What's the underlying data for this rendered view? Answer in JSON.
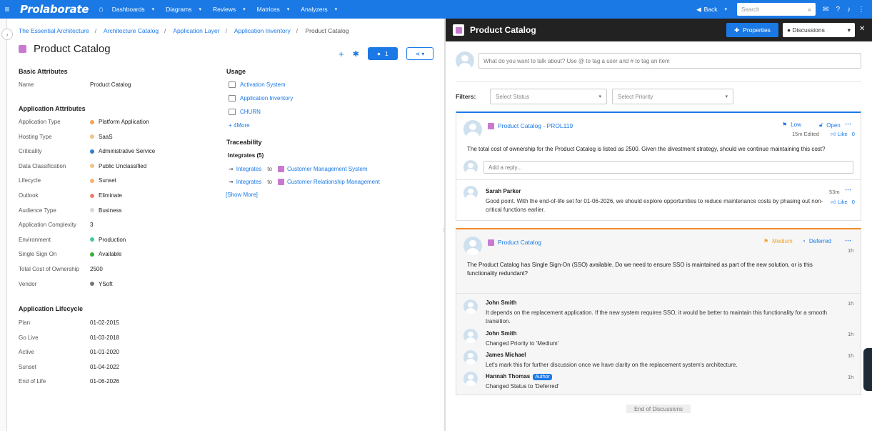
{
  "topbar": {
    "logo": "Prolaborate",
    "nav": [
      "Dashboards",
      "Diagrams",
      "Reviews",
      "Matrices",
      "Analyzers"
    ],
    "back_label": "Back",
    "search_placeholder": "Search",
    "accent": "#1b79e6"
  },
  "breadcrumb": [
    "The Essential Architecture",
    "Architecture Catalog",
    "Application Layer",
    "Application Inventory",
    "Product Catalog"
  ],
  "page": {
    "title": "Product Catalog",
    "comment_count": "1"
  },
  "basic": {
    "title": "Basic Attributes",
    "rows": [
      {
        "label": "Name",
        "value": "Product Catalog"
      }
    ]
  },
  "app_attrs": {
    "title": "Application Attributes",
    "rows": [
      {
        "label": "Application Type",
        "value": "Platform Application",
        "color": "#f5a35a"
      },
      {
        "label": "Hosting Type",
        "value": "SaaS",
        "color": "#f5c08a"
      },
      {
        "label": "Criticality",
        "value": "Administrative Service",
        "color": "#2f7fd0"
      },
      {
        "label": "Data Classification",
        "value": "Public Unclassified",
        "color": "#f5c08a"
      },
      {
        "label": "Lifecycle",
        "value": "Sunset",
        "color": "#f5b070"
      },
      {
        "label": "Outlook",
        "value": "Eliminate",
        "color": "#ef7e6e"
      },
      {
        "label": "Audience Type",
        "value": "Business",
        "color": "#d8d8d8"
      },
      {
        "label": "Application Complexity",
        "value": "3",
        "color": ""
      },
      {
        "label": "Environment",
        "value": "Production",
        "color": "#46c79a"
      },
      {
        "label": "Single Sign On",
        "value": "Available",
        "color": "#3bab3b"
      },
      {
        "label": "Total Cost of Ownership",
        "value": "2500",
        "color": ""
      },
      {
        "label": "Vendor",
        "value": "YSoft",
        "color": "#777777"
      }
    ]
  },
  "lifecycle": {
    "title": "Application Lifecycle",
    "rows": [
      {
        "label": "Plan",
        "value": "01-02-2015"
      },
      {
        "label": "Go Live",
        "value": "01-03-2018"
      },
      {
        "label": "Active",
        "value": "01-01-2020"
      },
      {
        "label": "Sunset",
        "value": "01-04-2022"
      },
      {
        "label": "End of Life",
        "value": "01-06-2026"
      }
    ]
  },
  "usage": {
    "title": "Usage",
    "items": [
      "Activation System",
      "Application Inventory",
      "CHURN"
    ],
    "more": "+ 4More"
  },
  "traceability": {
    "title": "Traceability",
    "subtitle": "Integrates (5)",
    "rows": [
      {
        "rel": "Integrates",
        "to": "to",
        "target": "Customer Management System"
      },
      {
        "rel": "Integrates",
        "to": "to",
        "target": "Customer Relationship Management"
      }
    ],
    "show_more": "[Show More]"
  },
  "right": {
    "title": "Product Catalog",
    "properties_label": "Properties",
    "discussions_label": "Discussions",
    "new_post_placeholder": "What do you want to talk about? Use @ to tag a user and # to tag an item",
    "filters_label": "Filters:",
    "status_placeholder": "Select Status",
    "priority_placeholder": "Select Priority",
    "end_label": "End of Discussions"
  },
  "discussion1": {
    "title": "Product Catalog - PROL119",
    "priority": "Low",
    "status": "Open",
    "time": "15m Edited",
    "like": "Like",
    "like_count": "0",
    "body": "The total cost of ownership for the Product Catalog is listed as 2500. Given the divestment strategy, should we continue maintaining this cost?",
    "reply_placeholder": "Add a reply...",
    "reply": {
      "name": "Sarah Parker",
      "time": "53m",
      "text": "Good point. With the end-of-life set for 01-06-2026, we should explore opportunities to reduce maintenance costs by phasing out non-critical functions earlier.",
      "like": "Like",
      "like_count": "0"
    }
  },
  "discussion2": {
    "title": "Product Catalog",
    "priority": "Medium",
    "status": "Deferred",
    "time": "1h",
    "body": "The Product Catalog has Single Sign-On (SSO) available. Do we need to ensure SSO is maintained as part of the new solution, or is this functionality redundant?",
    "replies": [
      {
        "name": "John Smith",
        "time": "1h",
        "text": "It depends on the replacement application. If the new system requires SSO, it would be better to maintain this functionality for a smooth transition.",
        "badge": ""
      },
      {
        "name": "John Smith",
        "time": "1h",
        "text": "Changed Priority to 'Medium'",
        "badge": ""
      },
      {
        "name": "James Michael",
        "time": "1h",
        "text": "Let's mark this for further discussion once we have clarity on the replacement system's architecture.",
        "badge": ""
      },
      {
        "name": "Hannah Thomas",
        "time": "1h",
        "text": "Changed Status to 'Deferred'",
        "badge": "Author"
      }
    ]
  }
}
